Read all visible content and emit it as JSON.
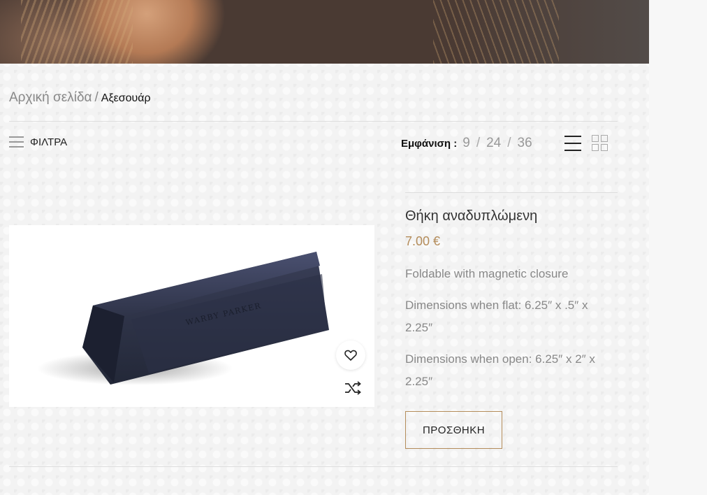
{
  "breadcrumb": {
    "home": "Αρχική σελίδα",
    "separator": "/",
    "current": "Αξεσουάρ"
  },
  "toolbar": {
    "filters_label": "ΦΙΛΤΡΑ",
    "show_label": "Εμφάνιση :",
    "per_page_options": [
      "9",
      "24",
      "36"
    ],
    "slash": "/",
    "active_view": "list"
  },
  "product": {
    "title": "Θήκη αναδυπλώμενη",
    "price": "7.00 €",
    "description": [
      "Foldable with magnetic closure",
      "Dimensions when flat: 6.25″ x .5″ x 2.25″",
      "Dimensions when open: 6.25″ x 2″ x 2.25″"
    ],
    "image_brand_text": "WARBY PARKER",
    "add_to_cart_label": "ΠΡΟΣΘΗΚΗ"
  },
  "colors": {
    "accent": "#b48c5a",
    "text": "#222222",
    "muted": "#888888"
  },
  "icons": {
    "wishlist": "heart-icon",
    "compare": "shuffle-icon",
    "filters": "hamburger-icon",
    "list_view": "list-view-icon",
    "grid_view": "grid-view-icon"
  }
}
